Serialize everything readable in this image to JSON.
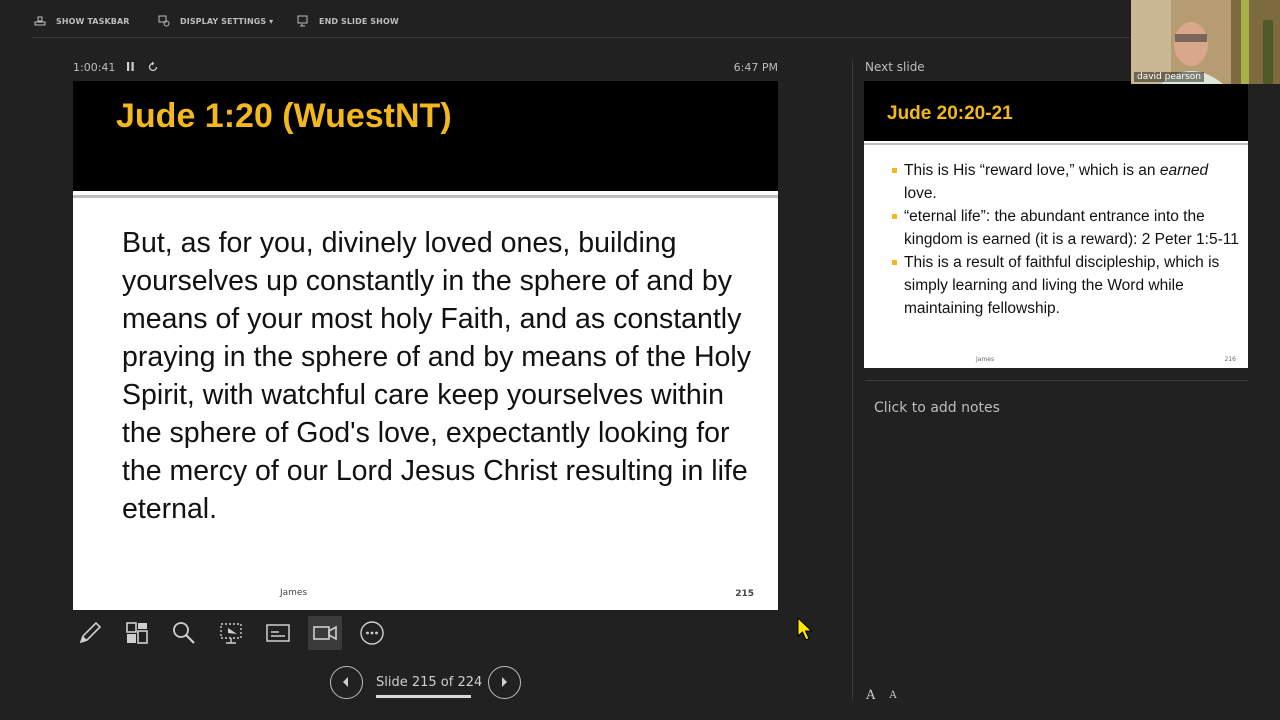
{
  "toolbar": {
    "show_taskbar": "SHOW TASKBAR",
    "display_settings": "DISPLAY SETTINGS ▾",
    "end_slide_show": "END SLIDE SHOW"
  },
  "timer": {
    "elapsed": "1:00:41",
    "clock": "6:47 PM"
  },
  "current_slide": {
    "title": "Jude 1:20 (WuestNT)",
    "body": "But, as for you, divinely loved ones, building yourselves up constantly in the sphere of and by means of your most holy Faith, and as constantly praying in the sphere of and by means of the Holy Spirit, with watchful care keep yourselves within the sphere of God's love, expectantly looking for the mercy of our Lord Jesus Christ resulting in life eternal.",
    "footer": "James",
    "number": "215"
  },
  "tools": [
    "pen-icon",
    "see-all-slides-icon",
    "zoom-icon",
    "pointer-icon",
    "subtitles-icon",
    "camera-icon",
    "more-options-icon"
  ],
  "navigation": {
    "label": "Slide 215 of 224"
  },
  "next_slide": {
    "heading": "Next slide",
    "title": "Jude 20:20-21",
    "bullets": [
      {
        "pre": " This is His “reward love,” which is an ",
        "em": "earned",
        "post": " love."
      },
      {
        "pre": "“eternal life”: the abundant entrance into the kingdom is earned (it is a reward): 2 Peter 1:5-11",
        "em": "",
        "post": ""
      },
      {
        "pre": "This is a result of faithful discipleship, which is simply learning and living the Word while maintaining fellowship.",
        "em": "",
        "post": ""
      }
    ],
    "footer": "James",
    "number": "216"
  },
  "notes": {
    "placeholder": "Click to add notes"
  },
  "font_buttons": {
    "increase": "A",
    "decrease": "A"
  },
  "participant": {
    "name": "david pearson"
  },
  "colors": {
    "accent": "#f2b81c",
    "background": "#212121"
  }
}
